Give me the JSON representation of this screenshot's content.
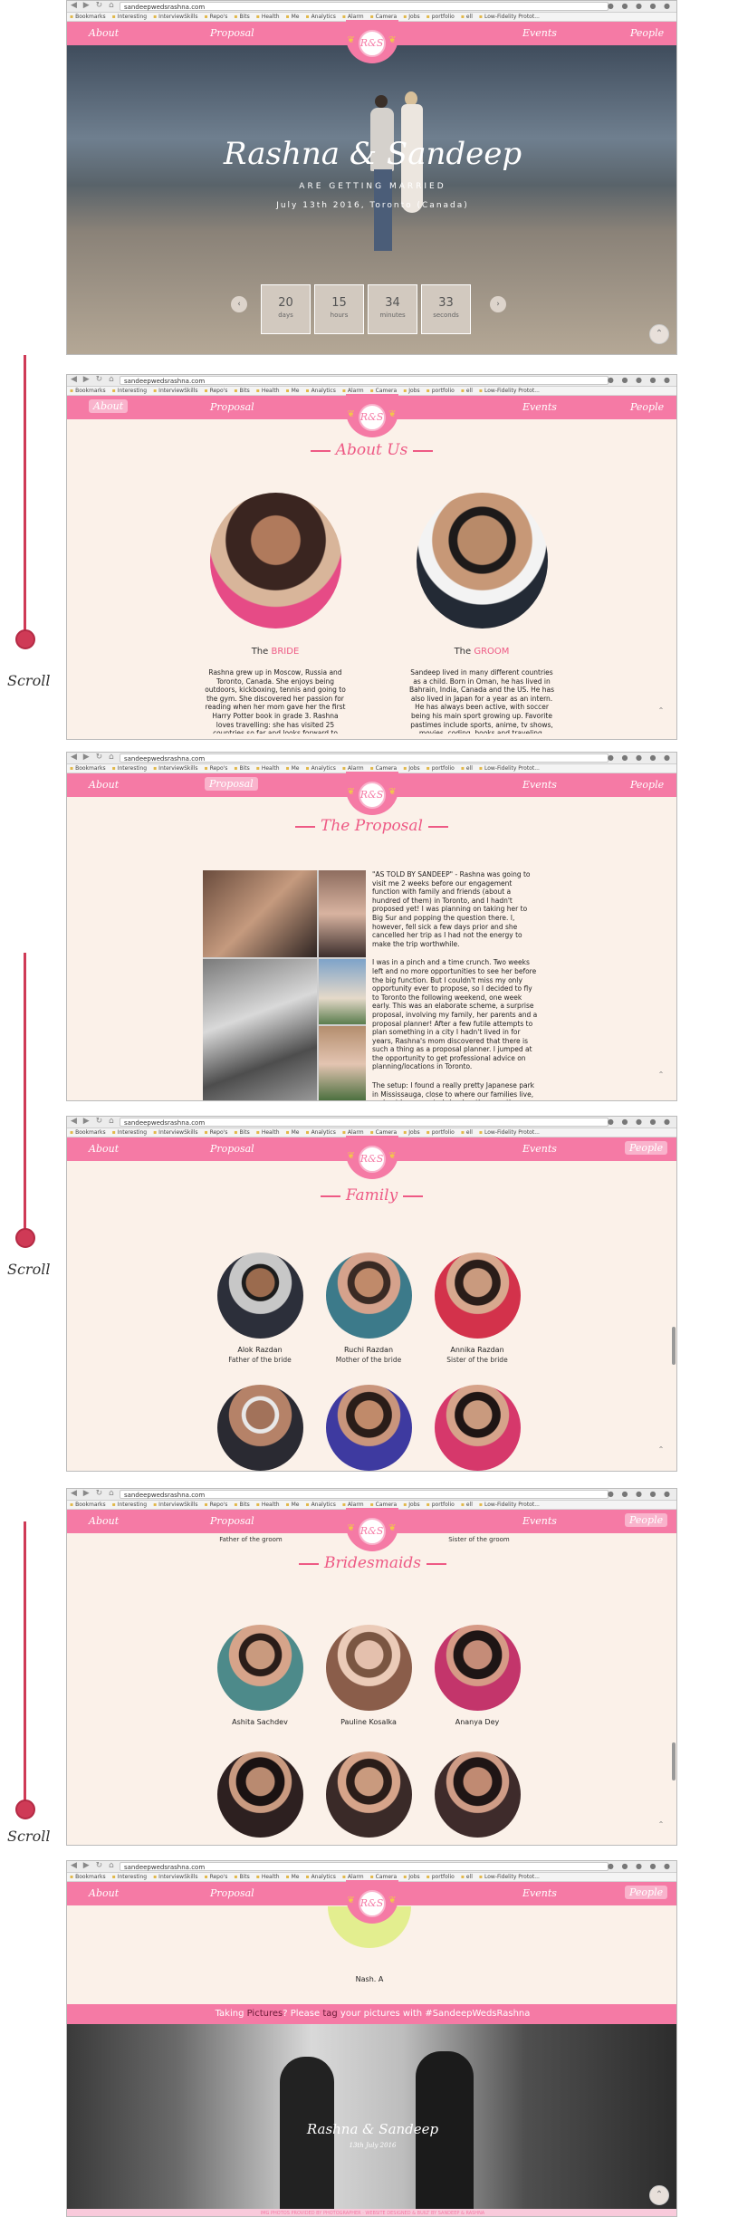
{
  "browser": {
    "url": "sandeepwedsrashna.com",
    "bookmarks": [
      "Bookmarks",
      "Interesting",
      "InterviewSkills",
      "Repo's",
      "Bits",
      "Health",
      "Me",
      "Analytics",
      "Alarm",
      "Camera",
      "Jobs",
      "portfolio",
      "ell",
      "Low-Fidelity Protot..."
    ]
  },
  "nav": {
    "about": "About",
    "proposal": "Proposal",
    "events": "Events",
    "people": "People",
    "logo": "R&S"
  },
  "hero": {
    "title": "Rashna & Sandeep",
    "subtitle": "ARE GETTING MARRIED",
    "date": "July 13th 2016, Toronto (Canada)",
    "countdown": [
      {
        "value": "20",
        "unit": "days"
      },
      {
        "value": "15",
        "unit": "hours"
      },
      {
        "value": "34",
        "unit": "minutes"
      },
      {
        "value": "33",
        "unit": "seconds"
      }
    ]
  },
  "about": {
    "title": "About Us",
    "bride_prefix": "The",
    "bride_label": "BRIDE",
    "bride_text": "Rashna grew up in Moscow, Russia and Toronto, Canada. She enjoys being outdoors, kickboxing, tennis and going to the gym. She discovered her passion for reading when her mom gave her the first Harry Potter book in grade 3. Rashna loves travelling: she has visited 25 countries so far and looks forward to exploring more.",
    "groom_prefix": "The",
    "groom_label": "GROOM",
    "groom_text": "Sandeep lived in many different countries as a child. Born in Oman, he has lived in Bahrain, India, Canada and the US. He has also lived in Japan for a year as an intern. He has always been active, with soccer being his main sport growing up. Favorite pastimes include sports, anime, tv shows, movies, coding, books and traveling."
  },
  "proposal": {
    "title": "The Proposal",
    "p1": "\"AS TOLD BY SANDEEP\" - Rashna was going to visit me 2 weeks before our engagement function with family and friends (about a hundred of them) in Toronto, and I hadn't proposed yet! I was planning on taking her to Big Sur and popping the question there. I, however, fell sick a few days prior and she cancelled her trip as I had not the energy to make the trip worthwhile.",
    "p2": "I was in a pinch and a time crunch. Two weeks left and no more opportunities to see her before the big function. But I couldn't miss my only opportunity ever to propose, so I decided to fly to Toronto the following weekend, one week early. This was an elaborate scheme, a surprise proposal, involving my family, her parents and a proposal planner! After a few futile attempts to plan something in a city I hadn't lived in for years, Rashna's mom discovered that there is such a thing as a proposal planner. I jumped at the opportunity to get professional advice on planning/locations in Toronto.",
    "p3": "The setup: I found a really pretty Japanese park in Mississauga, close to where our families live, and got her mom to bring her there on the pretense of meeting a..."
  },
  "family": {
    "title": "Family",
    "members": [
      {
        "name": "Alok Razdan",
        "role": "Father of the bride"
      },
      {
        "name": "Ruchi Razdan",
        "role": "Mother of the bride"
      },
      {
        "name": "Annika Razdan",
        "role": "Sister of the bride"
      },
      {
        "name": "",
        "role": ""
      },
      {
        "name": "",
        "role": ""
      },
      {
        "name": "",
        "role": ""
      }
    ]
  },
  "bridesmaids": {
    "title": "Bridesmaids",
    "cut_left": "Father of the groom",
    "cut_right": "Sister of the groom",
    "members": [
      {
        "name": "Ashita Sachdev"
      },
      {
        "name": "Pauline Kosalka"
      },
      {
        "name": "Ananya Dey"
      },
      {
        "name": ""
      },
      {
        "name": ""
      },
      {
        "name": ""
      }
    ]
  },
  "footer_section": {
    "last_name": "Nash. A",
    "banner_a": "Taking ",
    "banner_b": "Pictures",
    "banner_c": "? Please ",
    "banner_d": "tag",
    "banner_e": " your pictures with ",
    "banner_f": "#SandeepWedsRashna",
    "photo_title": "Rashna & Sandeep",
    "photo_sub": "13th July 2016",
    "fine_print": "IMG PHOTOS PROVIDED BY PHOTOGRAPHER · WEBSITE DESIGNED & BUILT BY SANDEEP & RASHNA"
  },
  "annotations": {
    "scroll": "Scroll"
  },
  "colors": {
    "pink": "#f57aa5",
    "cream": "#fbf1e9",
    "red": "#cf3a56"
  }
}
